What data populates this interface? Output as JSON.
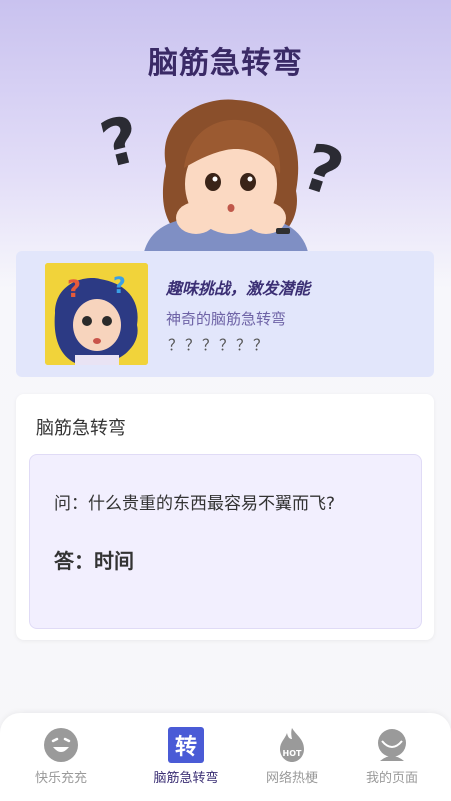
{
  "header": {
    "title": "脑筋急转弯"
  },
  "banner": {
    "headline": "趣味挑战，激发潜能",
    "subtitle": "神奇的脑筋急转弯",
    "marks": "？？？？？？"
  },
  "card": {
    "title": "脑筋急转弯",
    "question": "问：什么贵重的东西最容易不翼而飞?",
    "answer": "答：时间"
  },
  "tabbar": {
    "items": [
      {
        "label": "快乐充充",
        "icon": "smiley-face-icon",
        "active": false
      },
      {
        "label": "脑筋急转弯",
        "icon": "zhuan-character-icon",
        "icon_text": "转",
        "active": true
      },
      {
        "label": "网络热梗",
        "icon": "hot-flame-icon",
        "icon_text": "HOT",
        "active": false
      },
      {
        "label": "我的页面",
        "icon": "user-avatar-icon",
        "active": false
      }
    ]
  },
  "colors": {
    "accent": "#3b2f74",
    "tab_active_bg": "#4a5bd6",
    "tab_inactive": "#9a9a9a",
    "banner_bg": "#e2e6fb",
    "qa_bg": "#f2effe"
  }
}
